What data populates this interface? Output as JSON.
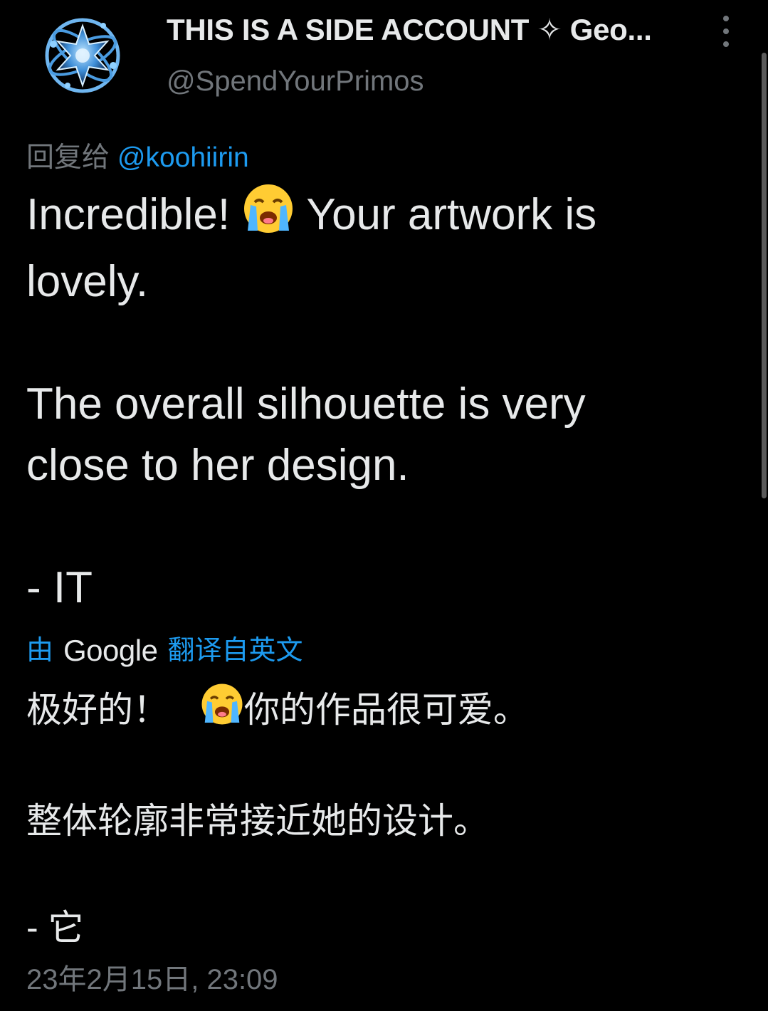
{
  "header": {
    "display_name": "THIS IS A SIDE ACCOUNT ✧ Geo...",
    "handle": "@SpendYourPrimos",
    "avatar_icon": "crystal-sphere-avatar",
    "more_icon": "vertical-ellipsis-icon"
  },
  "reply": {
    "prefix": "回复给",
    "mention": "@koohiirin"
  },
  "tweet": {
    "line1_before": "Incredible!",
    "line1_after": "Your artwork is",
    "line1_emoji": "loudly-crying-face-emoji",
    "line2": "lovely.",
    "line3": "The overall silhouette is very",
    "line4": "close to her design.",
    "line5": "- IT"
  },
  "translation_label": {
    "by": "由",
    "brand": "Google",
    "suffix": "翻译自英文"
  },
  "translation": {
    "line1_before": "极好的！",
    "line1_after": "你的作品很可爱。",
    "line2": "整体轮廓非常接近她的设计。",
    "line3": "- 它"
  },
  "timestamp": "23年2月15日, 23:09",
  "colors": {
    "background": "#000000",
    "text": "#e7e9ea",
    "muted": "#71767b",
    "link": "#1d9bf0"
  }
}
